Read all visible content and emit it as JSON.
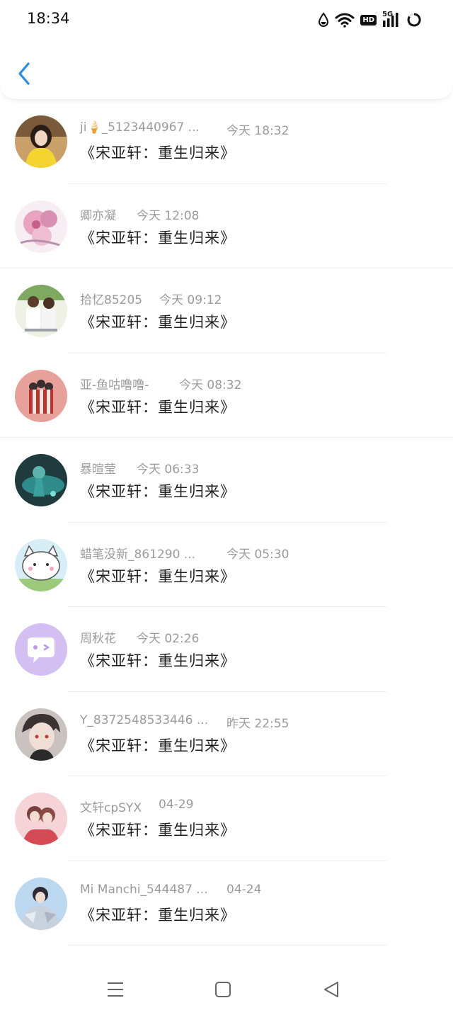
{
  "status_bar": {
    "time": "18:34",
    "network_label": "5G",
    "hd_label": "HD"
  },
  "header": {
    "back_icon": "chevron-left-icon",
    "accent_color": "#2a8de0"
  },
  "messages": [
    {
      "name": "ji🍦_5123440967 ...",
      "time": "今天 18:32",
      "text": "《宋亚轩：重生归来》",
      "avatar": "girl-yellow-photo"
    },
    {
      "name": "卿亦凝",
      "time": "今天 12:08",
      "text": "《宋亚轩：重生归来》",
      "avatar": "pink-flower-illustration"
    },
    {
      "name": "拾忆85205",
      "time": "今天 09:12",
      "text": "《宋亚轩：重生归来》",
      "avatar": "two-boys-photo"
    },
    {
      "name": "亚-鱼咕噜噜-",
      "time": "今天 08:32",
      "text": "《宋亚轩：重生归来》",
      "avatar": "popcorn-bucket-photo"
    },
    {
      "name": "暴暄莹",
      "time": "今天 06:33",
      "text": "《宋亚轩：重生归来》",
      "avatar": "teal-dark-illustration"
    },
    {
      "name": "蜡笔没新_861290 ...",
      "time": "今天 05:30",
      "text": "《宋亚轩：重生归来》",
      "avatar": "white-cat-cartoon"
    },
    {
      "name": "周秋花",
      "time": "今天 02:26",
      "text": "《宋亚轩：重生归来》",
      "avatar": "default-chat-bubble-avatar"
    },
    {
      "name": "Y_8372548533446 ...",
      "time": "昨天 22:55",
      "text": "《宋亚轩：重生归来》",
      "avatar": "anime-boy-illustration"
    },
    {
      "name": "文轩cpSYX",
      "time": "04-29",
      "text": "《宋亚轩：重生归来》",
      "avatar": "couple-photo"
    },
    {
      "name": "Mi Manchi_544487 ...",
      "time": "04-24",
      "text": "《宋亚轩：重生归来》",
      "avatar": "boy-silver-jacket-photo"
    }
  ],
  "nav_bar": {
    "menu_icon": "menu-icon",
    "home_icon": "home-square-icon",
    "back_icon": "back-triangle-icon"
  }
}
